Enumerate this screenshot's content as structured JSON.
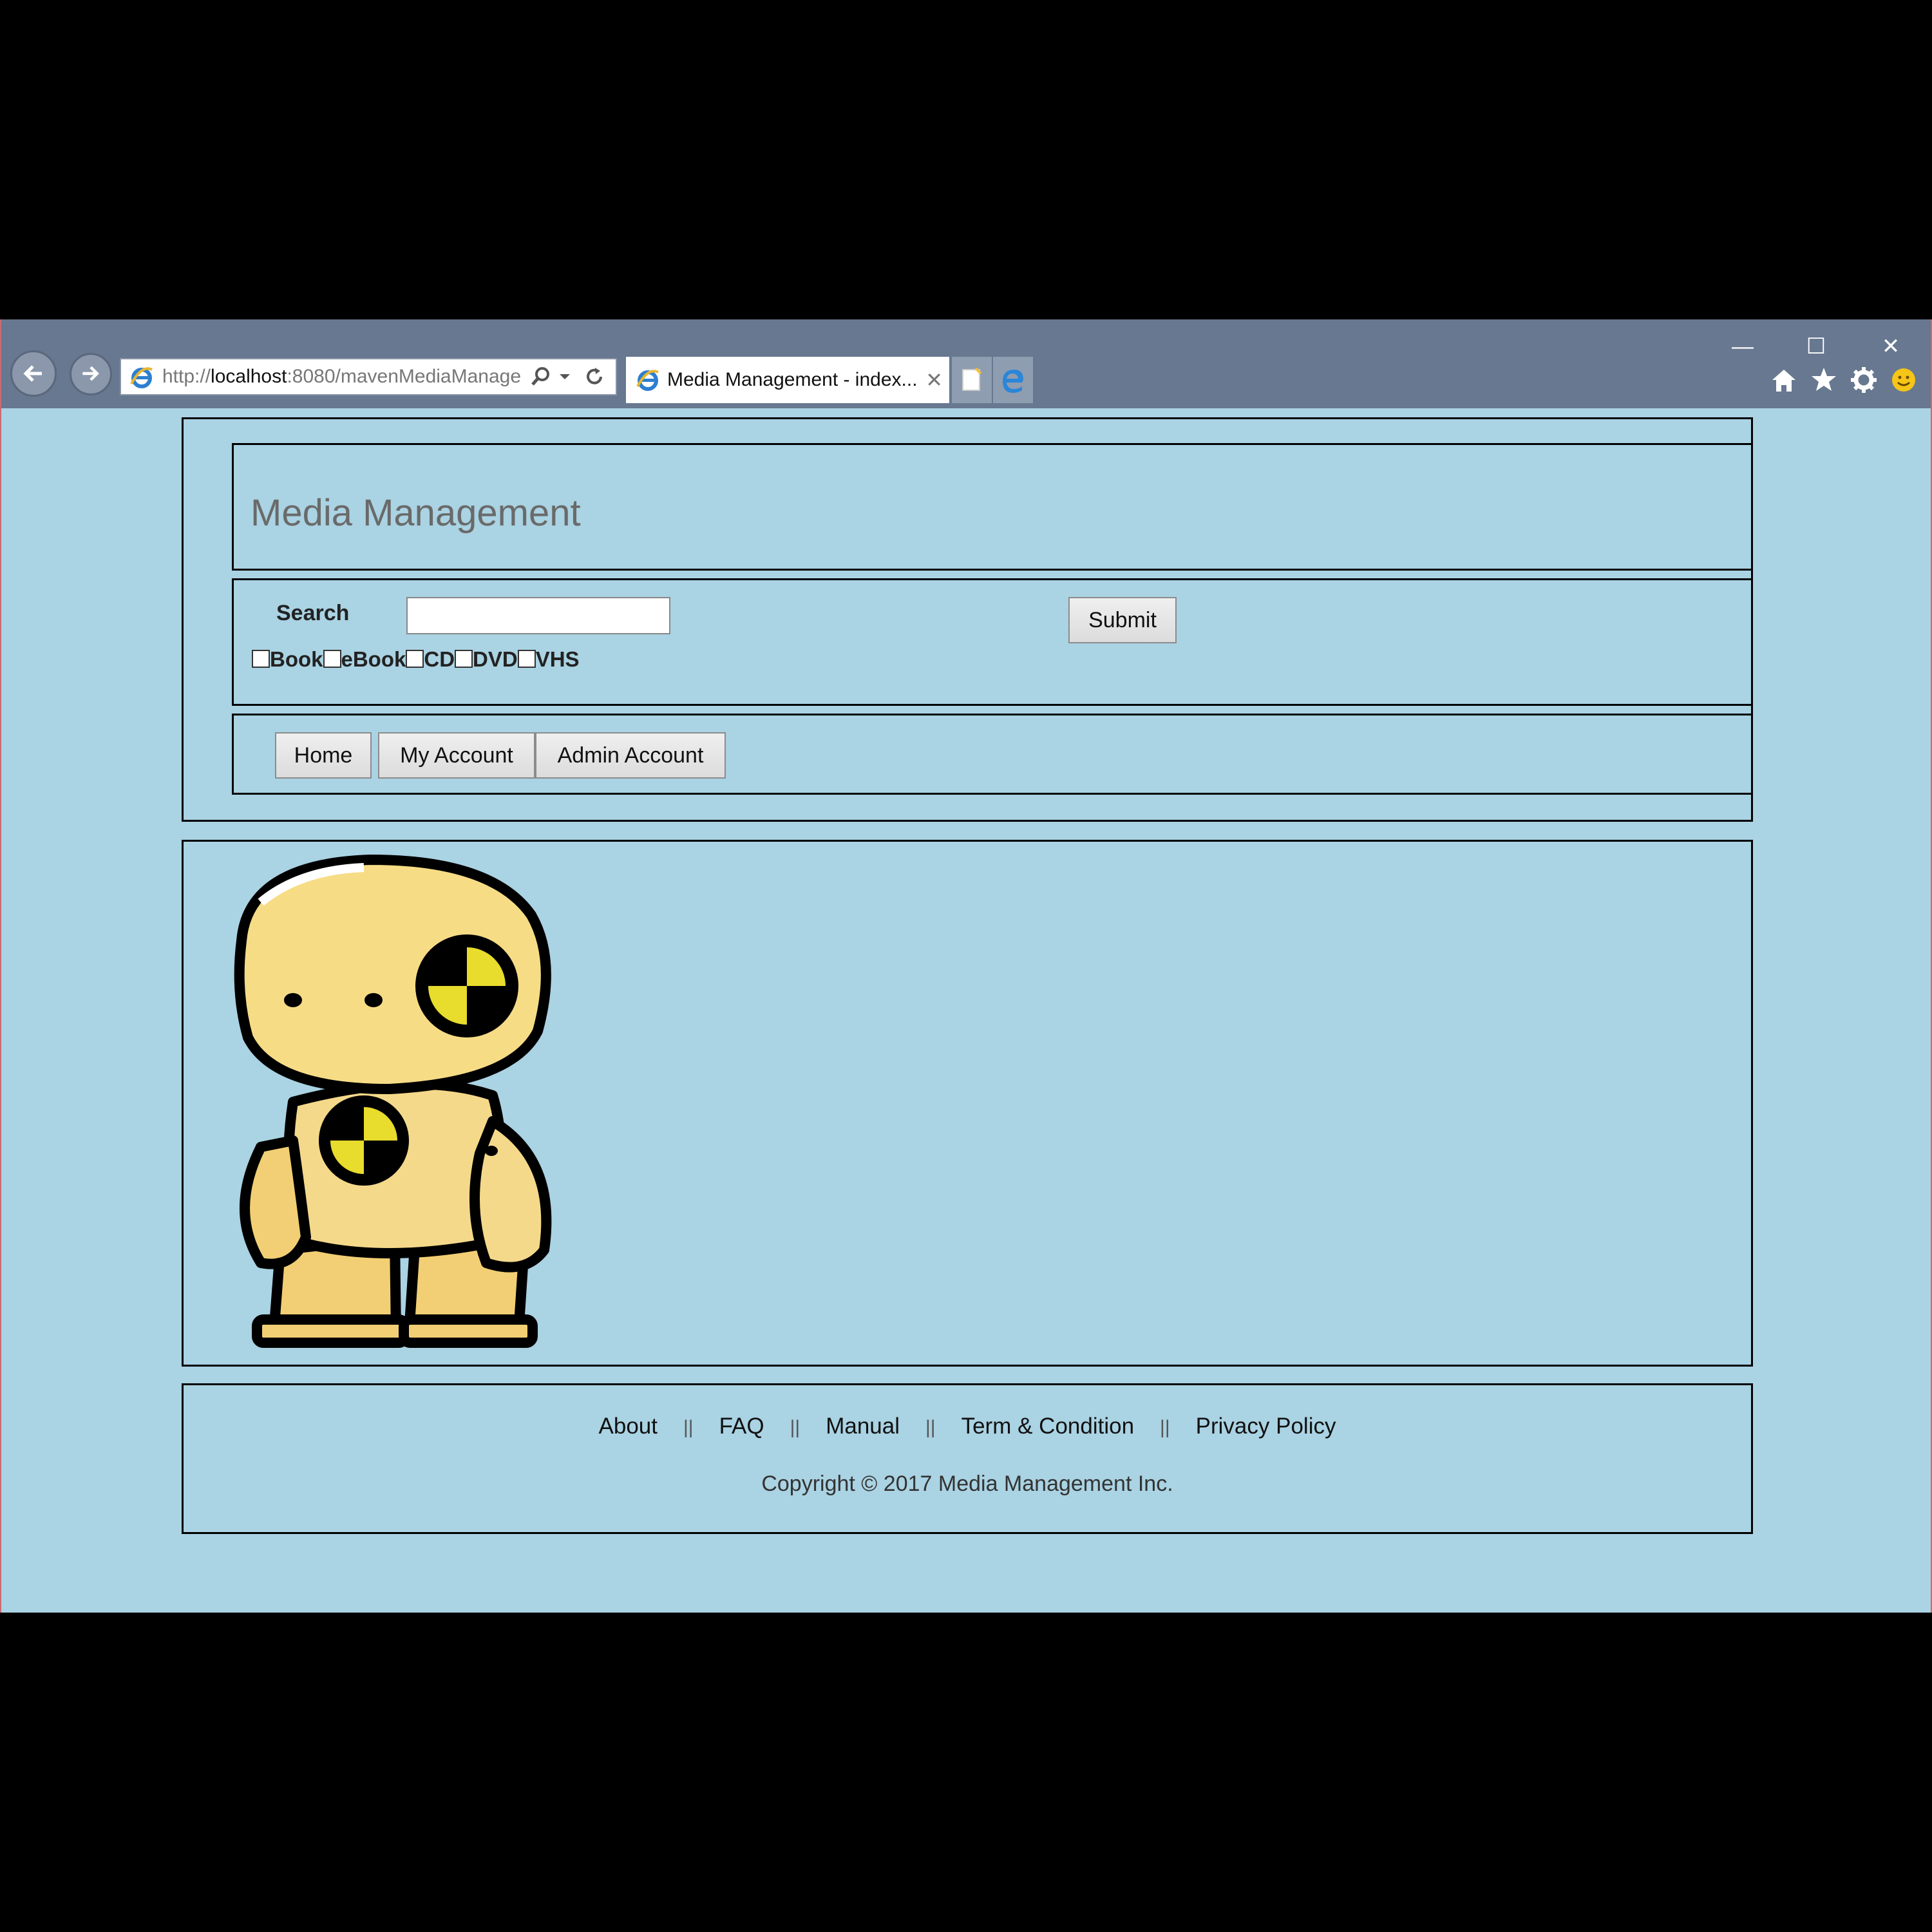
{
  "browser": {
    "address": {
      "prefix": "http://",
      "host": "localhost",
      "rest": ":8080/mavenMediaManage"
    },
    "tab_title": "Media Management - index..."
  },
  "header": {
    "title": "Media Management"
  },
  "search": {
    "label": "Search",
    "query": "",
    "submit_label": "Submit",
    "filters": [
      "Book",
      "eBook",
      "CD",
      "DVD",
      "VHS"
    ]
  },
  "nav": {
    "home": "Home",
    "my_account": "My Account",
    "admin_account": "Admin Account"
  },
  "footer": {
    "links": [
      "About",
      "FAQ",
      "Manual",
      "Term & Condition",
      "Privacy Policy"
    ],
    "separator": "||",
    "copyright": "Copyright © 2017 Media Management Inc."
  },
  "colors": {
    "page_bg": "#aad3e3",
    "chrome_bg": "#677890",
    "mascot_yellow": "#f7dc86"
  }
}
